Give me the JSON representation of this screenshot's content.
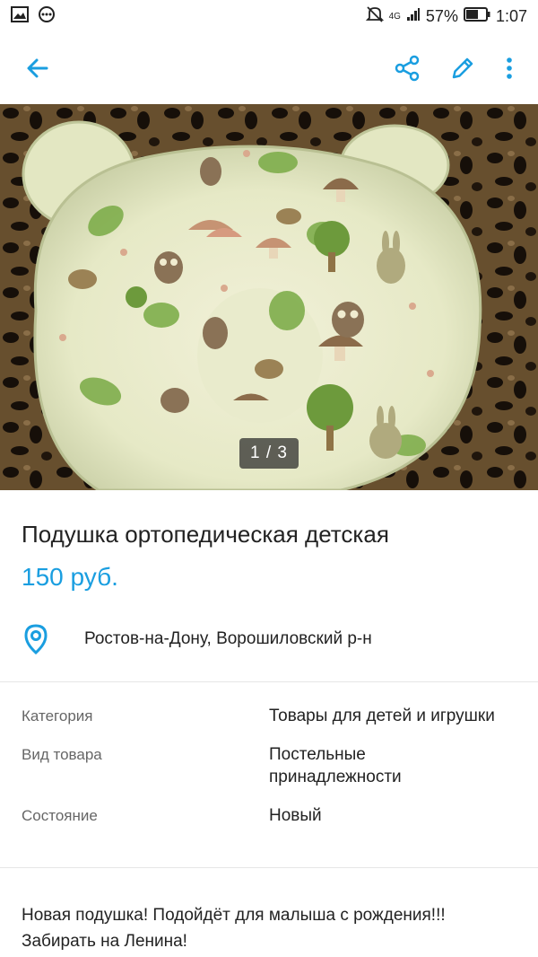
{
  "status_bar": {
    "network": "4G",
    "battery": "57%",
    "time": "1:07"
  },
  "gallery": {
    "counter": "1 / 3"
  },
  "item": {
    "title": "Подушка ортопедическая детская",
    "price": "150 руб.",
    "location": "Ростов-на-Дону, Ворошиловский р-н"
  },
  "params": [
    {
      "key": "Категория",
      "value": "Товары для детей и игрушки"
    },
    {
      "key": "Вид товара",
      "value": "Постельные принадлежности"
    },
    {
      "key": "Состояние",
      "value": "Новый"
    }
  ],
  "description": "Новая подушка! Подойдёт для малыша с рождения!!! Забирать на Ленина!",
  "colors": {
    "accent": "#1a9ee0",
    "text": "#222222",
    "muted": "#666666",
    "divider": "#e6e6e6"
  },
  "icons": {
    "back": "arrow-left-icon",
    "share": "share-icon",
    "edit": "pencil-icon",
    "more": "more-vertical-icon",
    "location": "map-pin-icon"
  }
}
